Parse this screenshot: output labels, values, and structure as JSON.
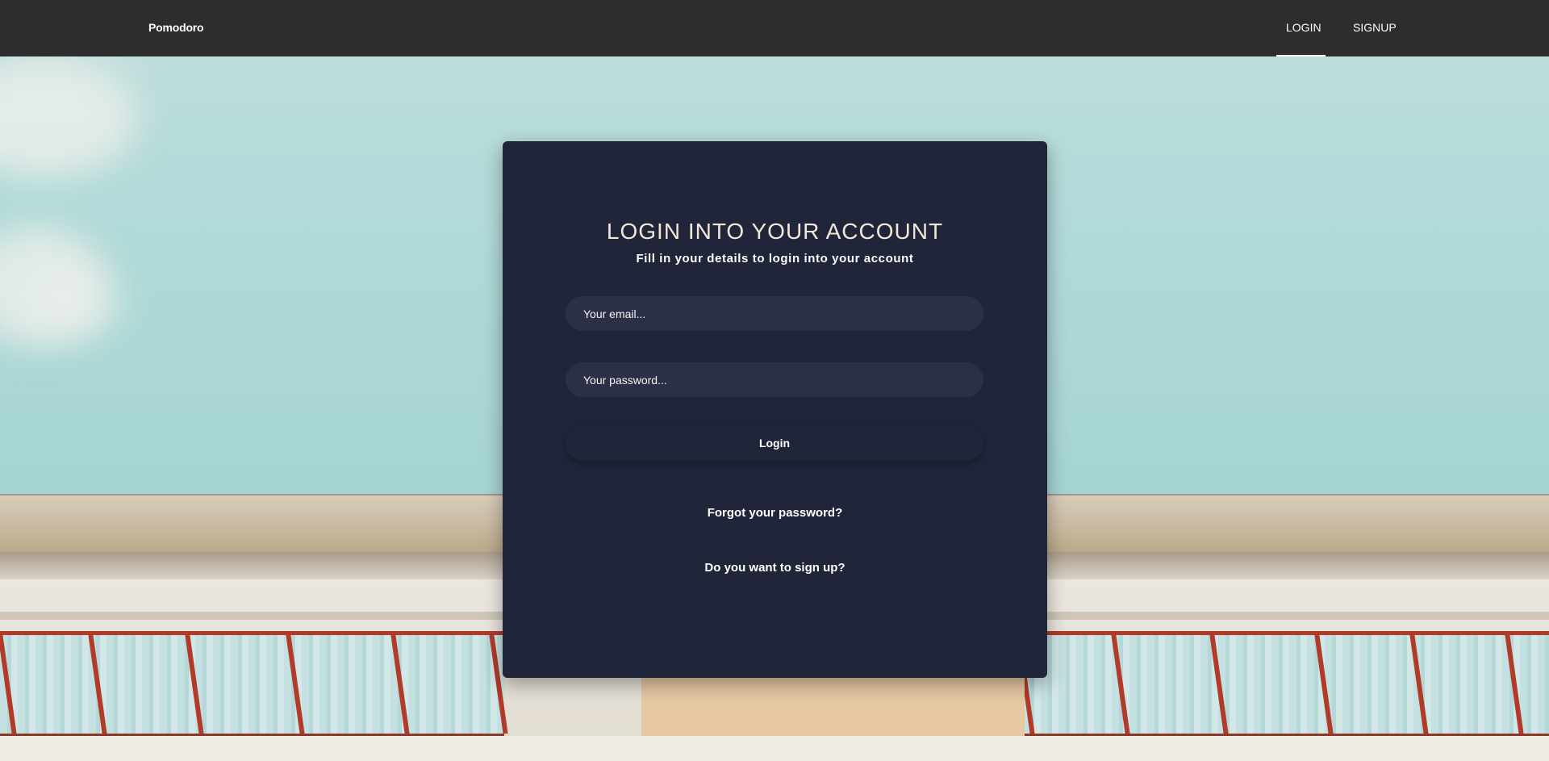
{
  "nav": {
    "brand": "Pomodoro",
    "links": [
      {
        "label": "LOGIN",
        "active": true
      },
      {
        "label": "SIGNUP",
        "active": false
      }
    ]
  },
  "card": {
    "title": "LOGIN INTO YOUR ACCOUNT",
    "subtitle": "Fill in your details to login into your account",
    "email_placeholder": "Your email...",
    "password_placeholder": "Your password...",
    "login_button": "Login",
    "forgot_link": "Forgot your password?",
    "signup_link": "Do you want to sign up?"
  },
  "colors": {
    "navbar": "#2d2d2d",
    "card": "#20253a",
    "input": "#2b3046",
    "title": "#f2e6d8"
  }
}
